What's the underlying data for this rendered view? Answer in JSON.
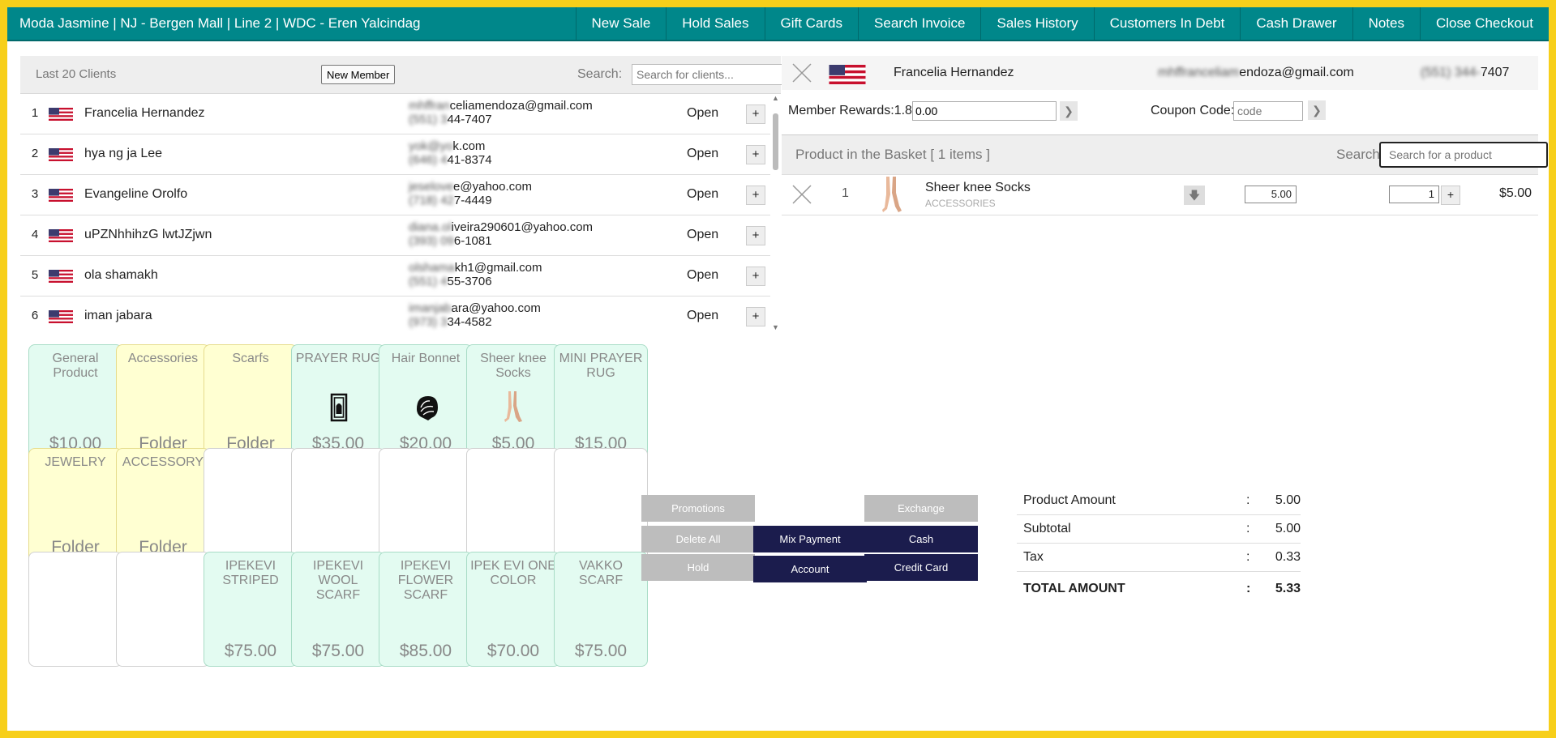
{
  "header": {
    "title": "Moda Jasmine | NJ - Bergen Mall | Line 2 | WDC - Eren Yalcindag",
    "nav": [
      "New Sale",
      "Hold Sales",
      "Gift Cards",
      "Search Invoice",
      "Sales History",
      "Customers In Debt",
      "Cash Drawer",
      "Notes",
      "Close Checkout"
    ]
  },
  "clients": {
    "heading": "Last 20 Clients",
    "new_member_label": "New Member",
    "search_label": "Search:",
    "search_placeholder": "Search for clients...",
    "rows": [
      {
        "num": "1",
        "name": "Francelia Hernandez",
        "email_hidden": "mhffran",
        "email": "celiamendoza@gmail.com",
        "phone_hidden": "(551) 3",
        "phone": "44-7407",
        "status": "Open"
      },
      {
        "num": "2",
        "name": "hya ng ja Lee",
        "email_hidden": "yok@yo",
        "email": "k.com",
        "phone_hidden": "(646) 4",
        "phone": "41-8374",
        "status": "Open"
      },
      {
        "num": "3",
        "name": "Evangeline Orolfo",
        "email_hidden": "jeselove",
        "email": "e@yahoo.com",
        "phone_hidden": "(718) 42",
        "phone": "7-4449",
        "status": "Open"
      },
      {
        "num": "4",
        "name": "uPZNhhihzG lwtJZjwn",
        "email_hidden": "diana.ol",
        "email": "iveira290601@yahoo.com",
        "phone_hidden": "(393) 09",
        "phone": "6-1081",
        "status": "Open"
      },
      {
        "num": "5",
        "name": "ola shamakh",
        "email_hidden": "olshama",
        "email": "kh1@gmail.com",
        "phone_hidden": "(551) 4",
        "phone": "55-3706",
        "status": "Open"
      },
      {
        "num": "6",
        "name": "iman jabara",
        "email_hidden": "imanjab",
        "email": "ara@yahoo.com",
        "phone_hidden": "(973) 3",
        "phone": "34-4582",
        "status": "Open"
      }
    ]
  },
  "tiles": [
    {
      "name": "General Product",
      "price": "$10.00",
      "color": "green",
      "icon": ""
    },
    {
      "name": "Accessories",
      "price": "Folder",
      "color": "yellow",
      "icon": ""
    },
    {
      "name": "Scarfs",
      "price": "Folder",
      "color": "yellow",
      "icon": ""
    },
    {
      "name": "PRAYER RUG",
      "price": "$35.00",
      "color": "green",
      "icon": "prayer-rug-icon"
    },
    {
      "name": "Hair Bonnet",
      "price": "$20.00",
      "color": "green",
      "icon": "hair-bonnet-icon"
    },
    {
      "name": "Sheer knee Socks",
      "price": "$5.00",
      "color": "green",
      "icon": "socks-icon"
    },
    {
      "name": "MINI PRAYER RUG",
      "price": "$15.00",
      "color": "green",
      "icon": ""
    },
    {
      "name": "JEWELRY",
      "price": "Folder",
      "color": "yellow",
      "icon": ""
    },
    {
      "name": "ACCESSORY",
      "price": "Folder",
      "color": "yellow",
      "icon": ""
    },
    {
      "name": "",
      "price": "",
      "color": "empty",
      "icon": ""
    },
    {
      "name": "",
      "price": "",
      "color": "empty",
      "icon": ""
    },
    {
      "name": "",
      "price": "",
      "color": "empty",
      "icon": ""
    },
    {
      "name": "",
      "price": "",
      "color": "empty",
      "icon": ""
    },
    {
      "name": "",
      "price": "",
      "color": "empty",
      "icon": ""
    },
    {
      "name": "",
      "price": "",
      "color": "empty",
      "icon": ""
    },
    {
      "name": "",
      "price": "",
      "color": "empty",
      "icon": ""
    },
    {
      "name": "IPEKEVI STRIPED",
      "price": "$75.00",
      "color": "green",
      "icon": ""
    },
    {
      "name": "IPEKEVI WOOL SCARF",
      "price": "$75.00",
      "color": "green",
      "icon": ""
    },
    {
      "name": "IPEKEVI FLOWER SCARF",
      "price": "$85.00",
      "color": "green",
      "icon": ""
    },
    {
      "name": "IPEK EVI ONE COLOR",
      "price": "$70.00",
      "color": "green",
      "icon": ""
    },
    {
      "name": "VAKKO SCARF",
      "price": "$75.00",
      "color": "green",
      "icon": ""
    }
  ],
  "customer": {
    "name": "Francelia Hernandez",
    "email_hidden": "mhffranceliam",
    "email": "endoza@gmail.com",
    "phone_hidden": "(551) 344-",
    "phone": "7407"
  },
  "rewards": {
    "label": "Member Rewards:1.8",
    "value": "0.00"
  },
  "coupon": {
    "label": "Coupon Code:",
    "placeholder": "code"
  },
  "basket": {
    "heading": "Product in the Basket [ 1 items ]",
    "search_label": "Search:",
    "search_placeholder": "Search for a product",
    "items": [
      {
        "num": "1",
        "name": "Sheer knee Socks",
        "category": "ACCESSORIES",
        "price": "5.00",
        "qty": "1",
        "total": "$5.00"
      }
    ]
  },
  "actions": {
    "promotions": "Promotions",
    "delete_all": "Delete All",
    "hold": "Hold",
    "mix_payment": "Mix Payment",
    "account": "Account",
    "exchange": "Exchange",
    "cash": "Cash",
    "credit_card": "Credit Card"
  },
  "totals": [
    {
      "label": "Product Amount",
      "sep": ":",
      "value": "5.00"
    },
    {
      "label": "Subtotal",
      "sep": ":",
      "value": "5.00"
    },
    {
      "label": "Tax",
      "sep": ":",
      "value": "0.33"
    },
    {
      "label": "TOTAL AMOUNT",
      "sep": ":",
      "value": "5.33"
    }
  ],
  "colors": {
    "topbar": "#00878a",
    "frame": "#f7cf1a",
    "navy": "#1b1c4d",
    "tile_green": "#e3fbf1",
    "tile_yellow": "#ffffd2"
  }
}
